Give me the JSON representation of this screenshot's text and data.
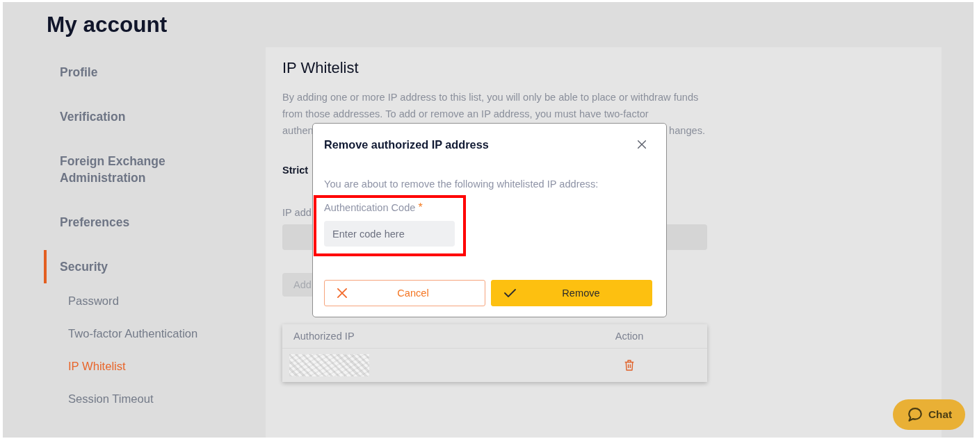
{
  "page": {
    "title": "My account"
  },
  "sidebar": {
    "items": [
      {
        "label": "Profile",
        "selected": false
      },
      {
        "label": "Verification",
        "selected": false
      },
      {
        "label": "Foreign Exchange Administration",
        "selected": false
      },
      {
        "label": "Preferences",
        "selected": false
      },
      {
        "label": "Security",
        "selected": true,
        "children": [
          {
            "label": "Password",
            "selected": false
          },
          {
            "label": "Two-factor Authentication",
            "selected": false
          },
          {
            "label": "IP Whitelist",
            "selected": true
          },
          {
            "label": "Session Timeout",
            "selected": false
          }
        ]
      }
    ]
  },
  "main": {
    "heading": "IP Whitelist",
    "description": {
      "lines": [
        "By adding one or more IP address to this list, you will only be able to place or withdraw funds",
        "from those addresses. To add or remove an IP address, you must have two-factor"
      ],
      "cut_start": "authen",
      "cut_end": "hanges."
    },
    "strict_label": "Strict",
    "ip_field": {
      "label": "IP add"
    },
    "add_button": "Add",
    "table": {
      "columns": [
        "Authorized IP",
        "Action"
      ],
      "rows": [
        {
          "redacted": true
        }
      ]
    }
  },
  "modal": {
    "title": "Remove authorized IP address",
    "message": "You are about to remove the following whitelisted IP address:",
    "field": {
      "label": "Authentication Code",
      "required_mark": "*",
      "placeholder": "Enter code here",
      "highlighted": true
    },
    "buttons": [
      {
        "label": "Cancel",
        "kind": "secondary"
      },
      {
        "label": "Remove",
        "kind": "primary"
      }
    ]
  },
  "chat_button": {
    "label": "Chat"
  }
}
